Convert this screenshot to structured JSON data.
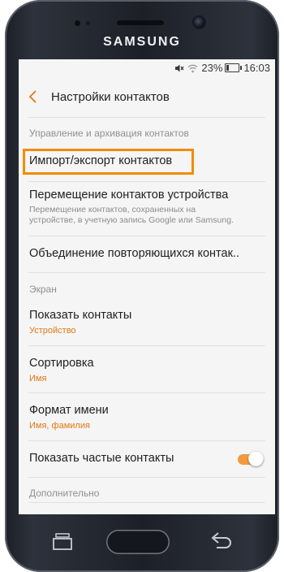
{
  "device": {
    "brand": "SAMSUNG"
  },
  "status_bar": {
    "battery_percent": "23%",
    "time": "16:03"
  },
  "header": {
    "title": "Настройки контактов"
  },
  "sections": {
    "management": "Управление и архивация контактов",
    "screen": "Экран",
    "additional": "Дополнительно"
  },
  "items": {
    "import_export": {
      "title": "Импорт/экспорт контактов",
      "highlighted": true
    },
    "move_contacts": {
      "title": "Перемещение контактов устройства",
      "subtitle_line1": "Перемещение контактов, сохраненных на",
      "subtitle_line2": "устройстве, в учетную запись Google или Samsung."
    },
    "merge": {
      "title": "Объединение повторяющихся контак.."
    },
    "show_contacts": {
      "title": "Показать контакты",
      "value": "Устройство"
    },
    "sort": {
      "title": "Сортировка",
      "value": "Имя"
    },
    "name_format": {
      "title": "Формат имени",
      "value": "Имя, фамилия"
    },
    "frequent": {
      "title": "Показать частые контакты",
      "enabled": true
    }
  },
  "colors": {
    "accent": "#e37814",
    "highlight": "#f28c00",
    "toggle_on": "#f29a3f"
  },
  "icons": [
    "mute-icon",
    "wifi-icon",
    "battery-icon",
    "back-arrow-icon",
    "recent-apps-icon",
    "home-button",
    "back-icon"
  ]
}
